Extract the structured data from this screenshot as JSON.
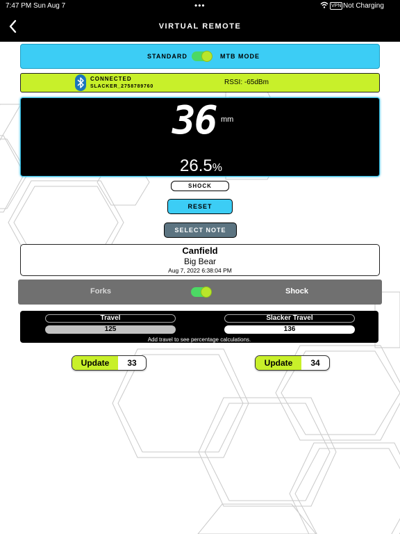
{
  "status_bar": {
    "time": "7:47 PM",
    "date": "Sun Aug 7",
    "charging": "Not Charging",
    "vpn": "VPN"
  },
  "nav": {
    "title": "VIRTUAL REMOTE"
  },
  "mode": {
    "left_label": "STANDARD",
    "right_label": "MTB MODE"
  },
  "connection": {
    "status": "CONNECTED",
    "device": "SLACKER_2758789760",
    "rssi": "RSSI: -65dBm"
  },
  "display": {
    "value": "36",
    "unit": "mm",
    "percent": "26.5",
    "percent_sign": "%"
  },
  "buttons": {
    "shock": "SHOCK",
    "reset": "RESET",
    "select_note": "SELECT NOTE"
  },
  "note": {
    "name": "Canfield",
    "location": "Big Bear",
    "date": "Aug 7, 2022 6:38:04 PM"
  },
  "suspension": {
    "left": "Forks",
    "right": "Shock"
  },
  "travel": {
    "left_label": "Travel",
    "left_value": "125",
    "right_label": "Slacker Travel",
    "right_value": "136",
    "note": "Add travel to see percentage calculations."
  },
  "updates": [
    {
      "label": "Update",
      "value": "33"
    },
    {
      "label": "Update",
      "value": "34"
    }
  ],
  "colors": {
    "cyan": "#3ccdf5",
    "lime": "#c8f02a",
    "toggle_green": "#4cd964",
    "note_button": "#5c7481",
    "bluetooth": "#1b75bc"
  }
}
